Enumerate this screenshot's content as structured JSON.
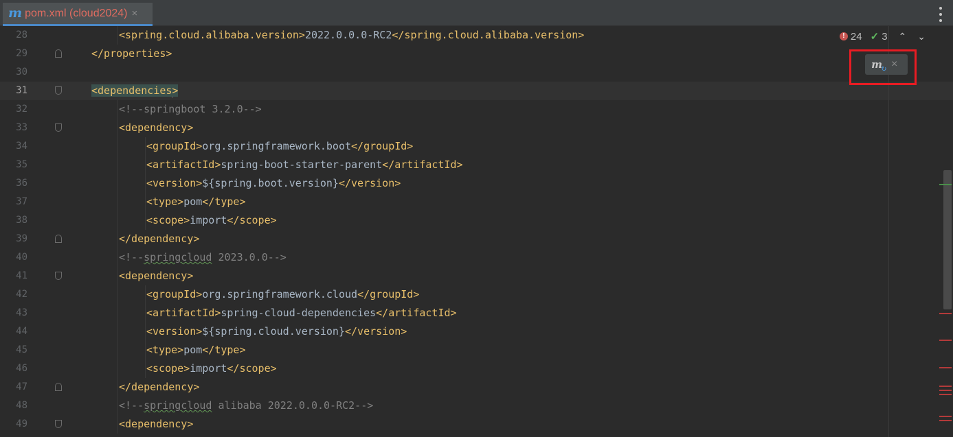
{
  "tab": {
    "icon": "maven-m-icon",
    "icon_glyph": "m",
    "label": "pom.xml (cloud2024)",
    "close": "×"
  },
  "inspection": {
    "error_glyph": "!",
    "errors": "24",
    "ok_glyph": "✓",
    "warnings": "3",
    "up": "⌃",
    "down": "⌄"
  },
  "maven_popup": {
    "glyph": "m",
    "refresh": "↻",
    "close": "×"
  },
  "lines": [
    {
      "n": "28",
      "indent": 1,
      "parts": [
        [
          "tag",
          "<spring.cloud.alibaba.version>"
        ],
        [
          "text",
          "2022.0.0.0-RC2"
        ],
        [
          "tag",
          "</spring.cloud.alibaba.version>"
        ]
      ]
    },
    {
      "n": "29",
      "indent": 0,
      "fold": "close",
      "parts": [
        [
          "tag",
          "</properties>"
        ]
      ]
    },
    {
      "n": "30",
      "indent": 0,
      "parts": []
    },
    {
      "n": "31",
      "indent": 0,
      "fold": "open",
      "current": true,
      "parts": [
        [
          "hl",
          "<dependencies"
        ],
        [
          "caret",
          ""
        ],
        [
          "hl",
          ">"
        ]
      ]
    },
    {
      "n": "32",
      "indent": 1,
      "parts": [
        [
          "comment",
          "<!--springboot 3.2.0-->"
        ]
      ]
    },
    {
      "n": "33",
      "indent": 1,
      "fold": "open",
      "parts": [
        [
          "tag",
          "<dependency>"
        ]
      ]
    },
    {
      "n": "34",
      "indent": 2,
      "parts": [
        [
          "tag",
          "<groupId>"
        ],
        [
          "text",
          "org.springframework.boot"
        ],
        [
          "tag",
          "</groupId>"
        ]
      ]
    },
    {
      "n": "35",
      "indent": 2,
      "parts": [
        [
          "tag",
          "<artifactId>"
        ],
        [
          "text",
          "spring-boot-starter-parent"
        ],
        [
          "tag",
          "</artifactId>"
        ]
      ]
    },
    {
      "n": "36",
      "indent": 2,
      "parts": [
        [
          "tag",
          "<version>"
        ],
        [
          "text",
          "${spring.boot.version}"
        ],
        [
          "tag",
          "</version>"
        ]
      ]
    },
    {
      "n": "37",
      "indent": 2,
      "parts": [
        [
          "tag",
          "<type>"
        ],
        [
          "text",
          "pom"
        ],
        [
          "tag",
          "</type>"
        ]
      ]
    },
    {
      "n": "38",
      "indent": 2,
      "parts": [
        [
          "tag",
          "<scope>"
        ],
        [
          "text",
          "import"
        ],
        [
          "tag",
          "</scope>"
        ]
      ]
    },
    {
      "n": "39",
      "indent": 1,
      "fold": "close",
      "parts": [
        [
          "tag",
          "</dependency>"
        ]
      ]
    },
    {
      "n": "40",
      "indent": 1,
      "parts": [
        [
          "comment",
          "<!--"
        ],
        [
          "squig",
          "springcloud"
        ],
        [
          "comment",
          " 2023.0.0-->"
        ]
      ]
    },
    {
      "n": "41",
      "indent": 1,
      "fold": "open",
      "parts": [
        [
          "tag",
          "<dependency>"
        ]
      ]
    },
    {
      "n": "42",
      "indent": 2,
      "parts": [
        [
          "tag",
          "<groupId>"
        ],
        [
          "text",
          "org.springframework.cloud"
        ],
        [
          "tag",
          "</groupId>"
        ]
      ]
    },
    {
      "n": "43",
      "indent": 2,
      "parts": [
        [
          "tag",
          "<artifactId>"
        ],
        [
          "text",
          "spring-cloud-dependencies"
        ],
        [
          "tag",
          "</artifactId>"
        ]
      ]
    },
    {
      "n": "44",
      "indent": 2,
      "parts": [
        [
          "tag",
          "<version>"
        ],
        [
          "text",
          "${spring.cloud.version}"
        ],
        [
          "tag",
          "</version>"
        ]
      ]
    },
    {
      "n": "45",
      "indent": 2,
      "parts": [
        [
          "tag",
          "<type>"
        ],
        [
          "text",
          "pom"
        ],
        [
          "tag",
          "</type>"
        ]
      ]
    },
    {
      "n": "46",
      "indent": 2,
      "parts": [
        [
          "tag",
          "<scope>"
        ],
        [
          "text",
          "import"
        ],
        [
          "tag",
          "</scope>"
        ]
      ]
    },
    {
      "n": "47",
      "indent": 1,
      "fold": "close",
      "parts": [
        [
          "tag",
          "</dependency>"
        ]
      ]
    },
    {
      "n": "48",
      "indent": 1,
      "parts": [
        [
          "comment",
          "<!--"
        ],
        [
          "squig",
          "springcloud"
        ],
        [
          "comment",
          " alibaba 2022.0.0.0-RC2-->"
        ]
      ]
    },
    {
      "n": "49",
      "indent": 1,
      "fold": "open",
      "parts": [
        [
          "tag",
          "<dependency>"
        ]
      ]
    }
  ],
  "colors": {
    "background": "#2b2b2b",
    "tag": "#e8bf6a",
    "text": "#a9b7c6",
    "comment": "#808080",
    "error": "#c75450",
    "accent": "#4a88c7",
    "highlight_box": "#e81c23"
  }
}
